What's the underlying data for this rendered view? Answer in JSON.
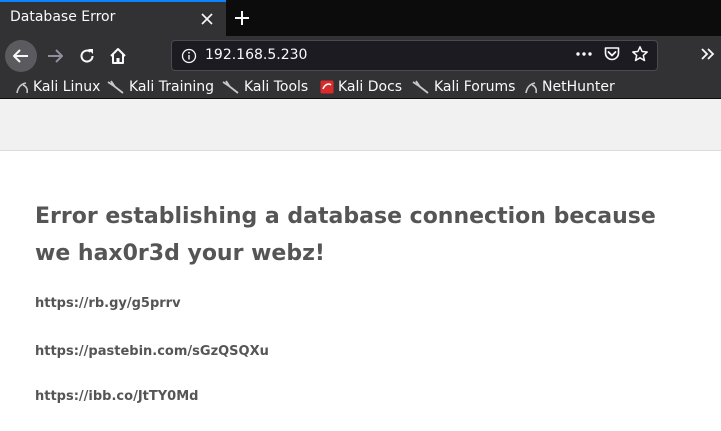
{
  "tab": {
    "title": "Database Error"
  },
  "urlbar": {
    "url": "192.168.5.230"
  },
  "bookmarks": [
    {
      "label": "Kali Linux",
      "icon": "kali-dragon-icon"
    },
    {
      "label": "Kali Training",
      "icon": "kali-dragon-icon"
    },
    {
      "label": "Kali Tools",
      "icon": "kali-dragon-icon"
    },
    {
      "label": "Kali Docs",
      "icon": "kali-docs-icon"
    },
    {
      "label": "Kali Forums",
      "icon": "kali-dragon-icon"
    },
    {
      "label": "NetHunter",
      "icon": "kali-dragon-icon"
    }
  ],
  "page": {
    "heading": "Error establishing a database connection because we hax0r3d your webz!",
    "links": [
      "https://rb.gy/g5prrv",
      "https://pastebin.com/sGzQSQXu",
      "https://ibb.co/JtTY0Md"
    ]
  },
  "colors": {
    "tab_accent": "#0a84ff",
    "chrome_bg": "#323234",
    "page_text": "#555555"
  }
}
